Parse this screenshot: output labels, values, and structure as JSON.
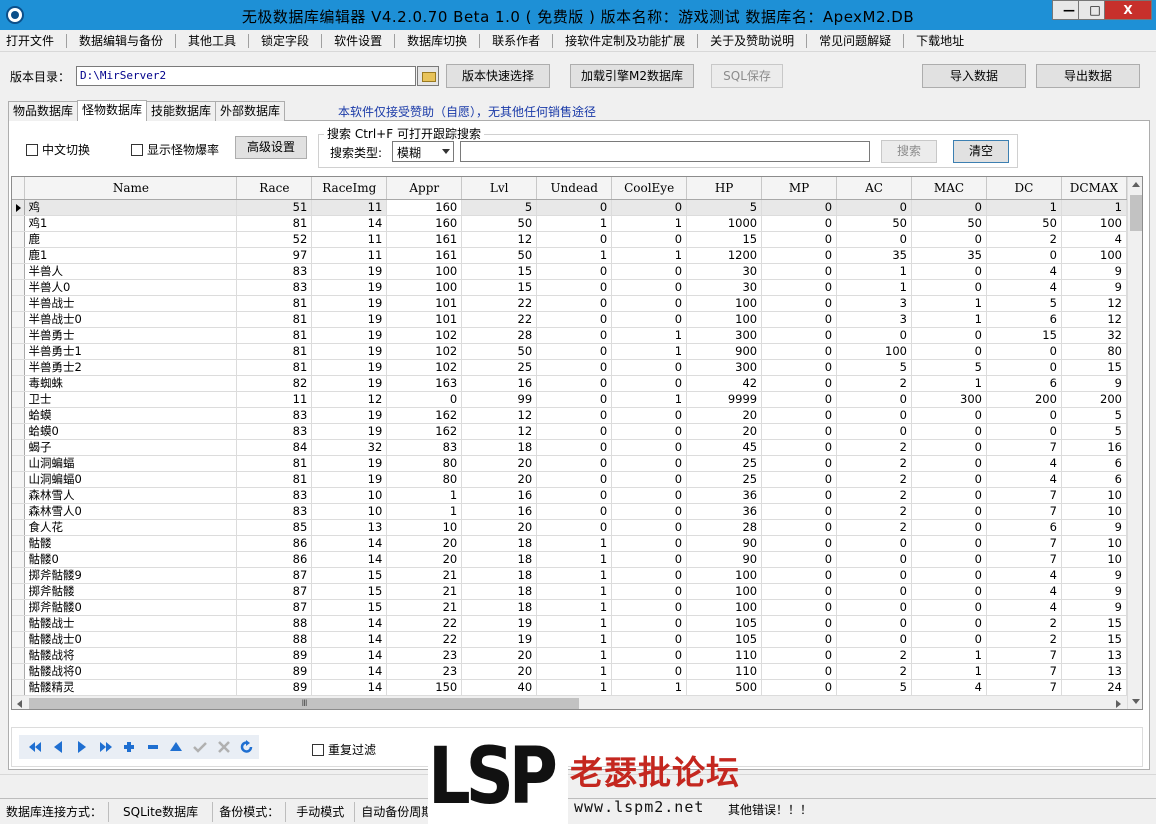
{
  "window": {
    "title": "无极数据库编辑器 V4.2.0.70    Beta 1.0 ( 免费版 )      版本名称：游戏测试      数据库名：ApexM2.DB",
    "min_label": "—",
    "max_label": "□",
    "close_label": "X"
  },
  "menu": [
    "打开文件",
    "数据编辑与备份",
    "其他工具",
    "锁定字段",
    "软件设置",
    "数据库切换",
    "联系作者",
    "接软件定制及功能扩展",
    "关于及赞助说明",
    "常见问题解疑",
    "下载地址"
  ],
  "toolbar": {
    "path_label": "版本目录：",
    "path_value": "D:\\MirServer2",
    "quick_select": "版本快速选择",
    "load_m2": "加载引擎M2数据库",
    "sql_save": "SQL保存",
    "import": "导入数据",
    "export": "导出数据"
  },
  "tabs": [
    "物品数据库",
    "怪物数据库",
    "技能数据库",
    "外部数据库"
  ],
  "tab_note": "本软件仅接受赞助（自愿），无其他任何销售途径",
  "controls": {
    "cn_switch": "中文切换",
    "show_drop": "显示怪物爆率",
    "advanced": "高级设置",
    "search_caption": "搜索   Ctrl+F  可打开跟踪搜索",
    "search_type_label": "搜索类型:",
    "search_type_value": "模糊",
    "search_button": "搜索",
    "clear_button": "清空"
  },
  "grid": {
    "columns": [
      "Name",
      "Race",
      "RaceImg",
      "Appr",
      "Lvl",
      "Undead",
      "CoolEye",
      "HP",
      "MP",
      "AC",
      "MAC",
      "DC",
      "DCMAX"
    ],
    "rows": [
      [
        "鸡",
        "51",
        "11",
        "160",
        "5",
        "0",
        "0",
        "5",
        "0",
        "0",
        "0",
        "1",
        "1"
      ],
      [
        "鸡1",
        "81",
        "14",
        "160",
        "50",
        "1",
        "1",
        "1000",
        "0",
        "50",
        "50",
        "50",
        "100"
      ],
      [
        "鹿",
        "52",
        "11",
        "161",
        "12",
        "0",
        "0",
        "15",
        "0",
        "0",
        "0",
        "2",
        "4"
      ],
      [
        "鹿1",
        "97",
        "11",
        "161",
        "50",
        "1",
        "1",
        "1200",
        "0",
        "35",
        "35",
        "0",
        "100"
      ],
      [
        "半兽人",
        "83",
        "19",
        "100",
        "15",
        "0",
        "0",
        "30",
        "0",
        "1",
        "0",
        "4",
        "9"
      ],
      [
        "半兽人0",
        "83",
        "19",
        "100",
        "15",
        "0",
        "0",
        "30",
        "0",
        "1",
        "0",
        "4",
        "9"
      ],
      [
        "半兽战士",
        "81",
        "19",
        "101",
        "22",
        "0",
        "0",
        "100",
        "0",
        "3",
        "1",
        "5",
        "12"
      ],
      [
        "半兽战士0",
        "81",
        "19",
        "101",
        "22",
        "0",
        "0",
        "100",
        "0",
        "3",
        "1",
        "6",
        "12"
      ],
      [
        "半兽勇士",
        "81",
        "19",
        "102",
        "28",
        "0",
        "1",
        "300",
        "0",
        "0",
        "0",
        "15",
        "32"
      ],
      [
        "半兽勇士1",
        "81",
        "19",
        "102",
        "50",
        "0",
        "1",
        "900",
        "0",
        "100",
        "0",
        "0",
        "80"
      ],
      [
        "半兽勇士2",
        "81",
        "19",
        "102",
        "25",
        "0",
        "0",
        "300",
        "0",
        "5",
        "5",
        "0",
        "15"
      ],
      [
        "毒蜘蛛",
        "82",
        "19",
        "163",
        "16",
        "0",
        "0",
        "42",
        "0",
        "2",
        "1",
        "6",
        "9"
      ],
      [
        "卫士",
        "11",
        "12",
        "0",
        "99",
        "0",
        "1",
        "9999",
        "0",
        "0",
        "300",
        "200",
        "200"
      ],
      [
        "蛤蟆",
        "83",
        "19",
        "162",
        "12",
        "0",
        "0",
        "20",
        "0",
        "0",
        "0",
        "0",
        "5"
      ],
      [
        "蛤蟆0",
        "83",
        "19",
        "162",
        "12",
        "0",
        "0",
        "20",
        "0",
        "0",
        "0",
        "0",
        "5"
      ],
      [
        "蝎子",
        "84",
        "32",
        "83",
        "18",
        "0",
        "0",
        "45",
        "0",
        "2",
        "0",
        "7",
        "16"
      ],
      [
        "山洞蝙蝠",
        "81",
        "19",
        "80",
        "20",
        "0",
        "0",
        "25",
        "0",
        "2",
        "0",
        "4",
        "6"
      ],
      [
        "山洞蝙蝠0",
        "81",
        "19",
        "80",
        "20",
        "0",
        "0",
        "25",
        "0",
        "2",
        "0",
        "4",
        "6"
      ],
      [
        "森林雪人",
        "83",
        "10",
        "1",
        "16",
        "0",
        "0",
        "36",
        "0",
        "2",
        "0",
        "7",
        "10"
      ],
      [
        "森林雪人0",
        "83",
        "10",
        "1",
        "16",
        "0",
        "0",
        "36",
        "0",
        "2",
        "0",
        "7",
        "10"
      ],
      [
        "食人花",
        "85",
        "13",
        "10",
        "20",
        "0",
        "0",
        "28",
        "0",
        "2",
        "0",
        "6",
        "9"
      ],
      [
        "骷髅",
        "86",
        "14",
        "20",
        "18",
        "1",
        "0",
        "90",
        "0",
        "0",
        "0",
        "7",
        "10"
      ],
      [
        "骷髅0",
        "86",
        "14",
        "20",
        "18",
        "1",
        "0",
        "90",
        "0",
        "0",
        "0",
        "7",
        "10"
      ],
      [
        "掷斧骷髅9",
        "87",
        "15",
        "21",
        "18",
        "1",
        "0",
        "100",
        "0",
        "0",
        "0",
        "4",
        "9"
      ],
      [
        "掷斧骷髅",
        "87",
        "15",
        "21",
        "18",
        "1",
        "0",
        "100",
        "0",
        "0",
        "0",
        "4",
        "9"
      ],
      [
        "掷斧骷髅0",
        "87",
        "15",
        "21",
        "18",
        "1",
        "0",
        "100",
        "0",
        "0",
        "0",
        "4",
        "9"
      ],
      [
        "骷髅战士",
        "88",
        "14",
        "22",
        "19",
        "1",
        "0",
        "105",
        "0",
        "0",
        "0",
        "2",
        "15"
      ],
      [
        "骷髅战士0",
        "88",
        "14",
        "22",
        "19",
        "1",
        "0",
        "105",
        "0",
        "0",
        "0",
        "2",
        "15"
      ],
      [
        "骷髅战将",
        "89",
        "14",
        "23",
        "20",
        "1",
        "0",
        "110",
        "0",
        "2",
        "1",
        "7",
        "13"
      ],
      [
        "骷髅战将0",
        "89",
        "14",
        "23",
        "20",
        "1",
        "0",
        "110",
        "0",
        "2",
        "1",
        "7",
        "13"
      ],
      [
        "骷髅精灵",
        "89",
        "14",
        "150",
        "40",
        "1",
        "1",
        "500",
        "0",
        "5",
        "4",
        "7",
        "24"
      ]
    ],
    "hscroll_grip": "III"
  },
  "navigator": {
    "buttons": [
      "first-icon",
      "prior-icon",
      "next-icon",
      "last-icon",
      "insert-icon",
      "delete-icon",
      "edit-icon",
      "post-icon",
      "cancel-icon",
      "refresh-icon"
    ],
    "repeat_filter": "重复过滤"
  },
  "status": {
    "conn_label": "数据库连接方式：",
    "conn_value": "SQLite数据库",
    "backup_label": "备份模式：",
    "backup_value": "手动模式",
    "auto_backup": "自动备份周期",
    "other": "其他错误！！！"
  },
  "watermark": {
    "logo": "LSP",
    "cn": "老瑟批论坛",
    "url": "www.lspm2.net"
  },
  "colors": {
    "titlebar": "#1e90d6",
    "close": "#c7302b",
    "note": "#1a3aa8",
    "logo_red": "#c4271f"
  }
}
